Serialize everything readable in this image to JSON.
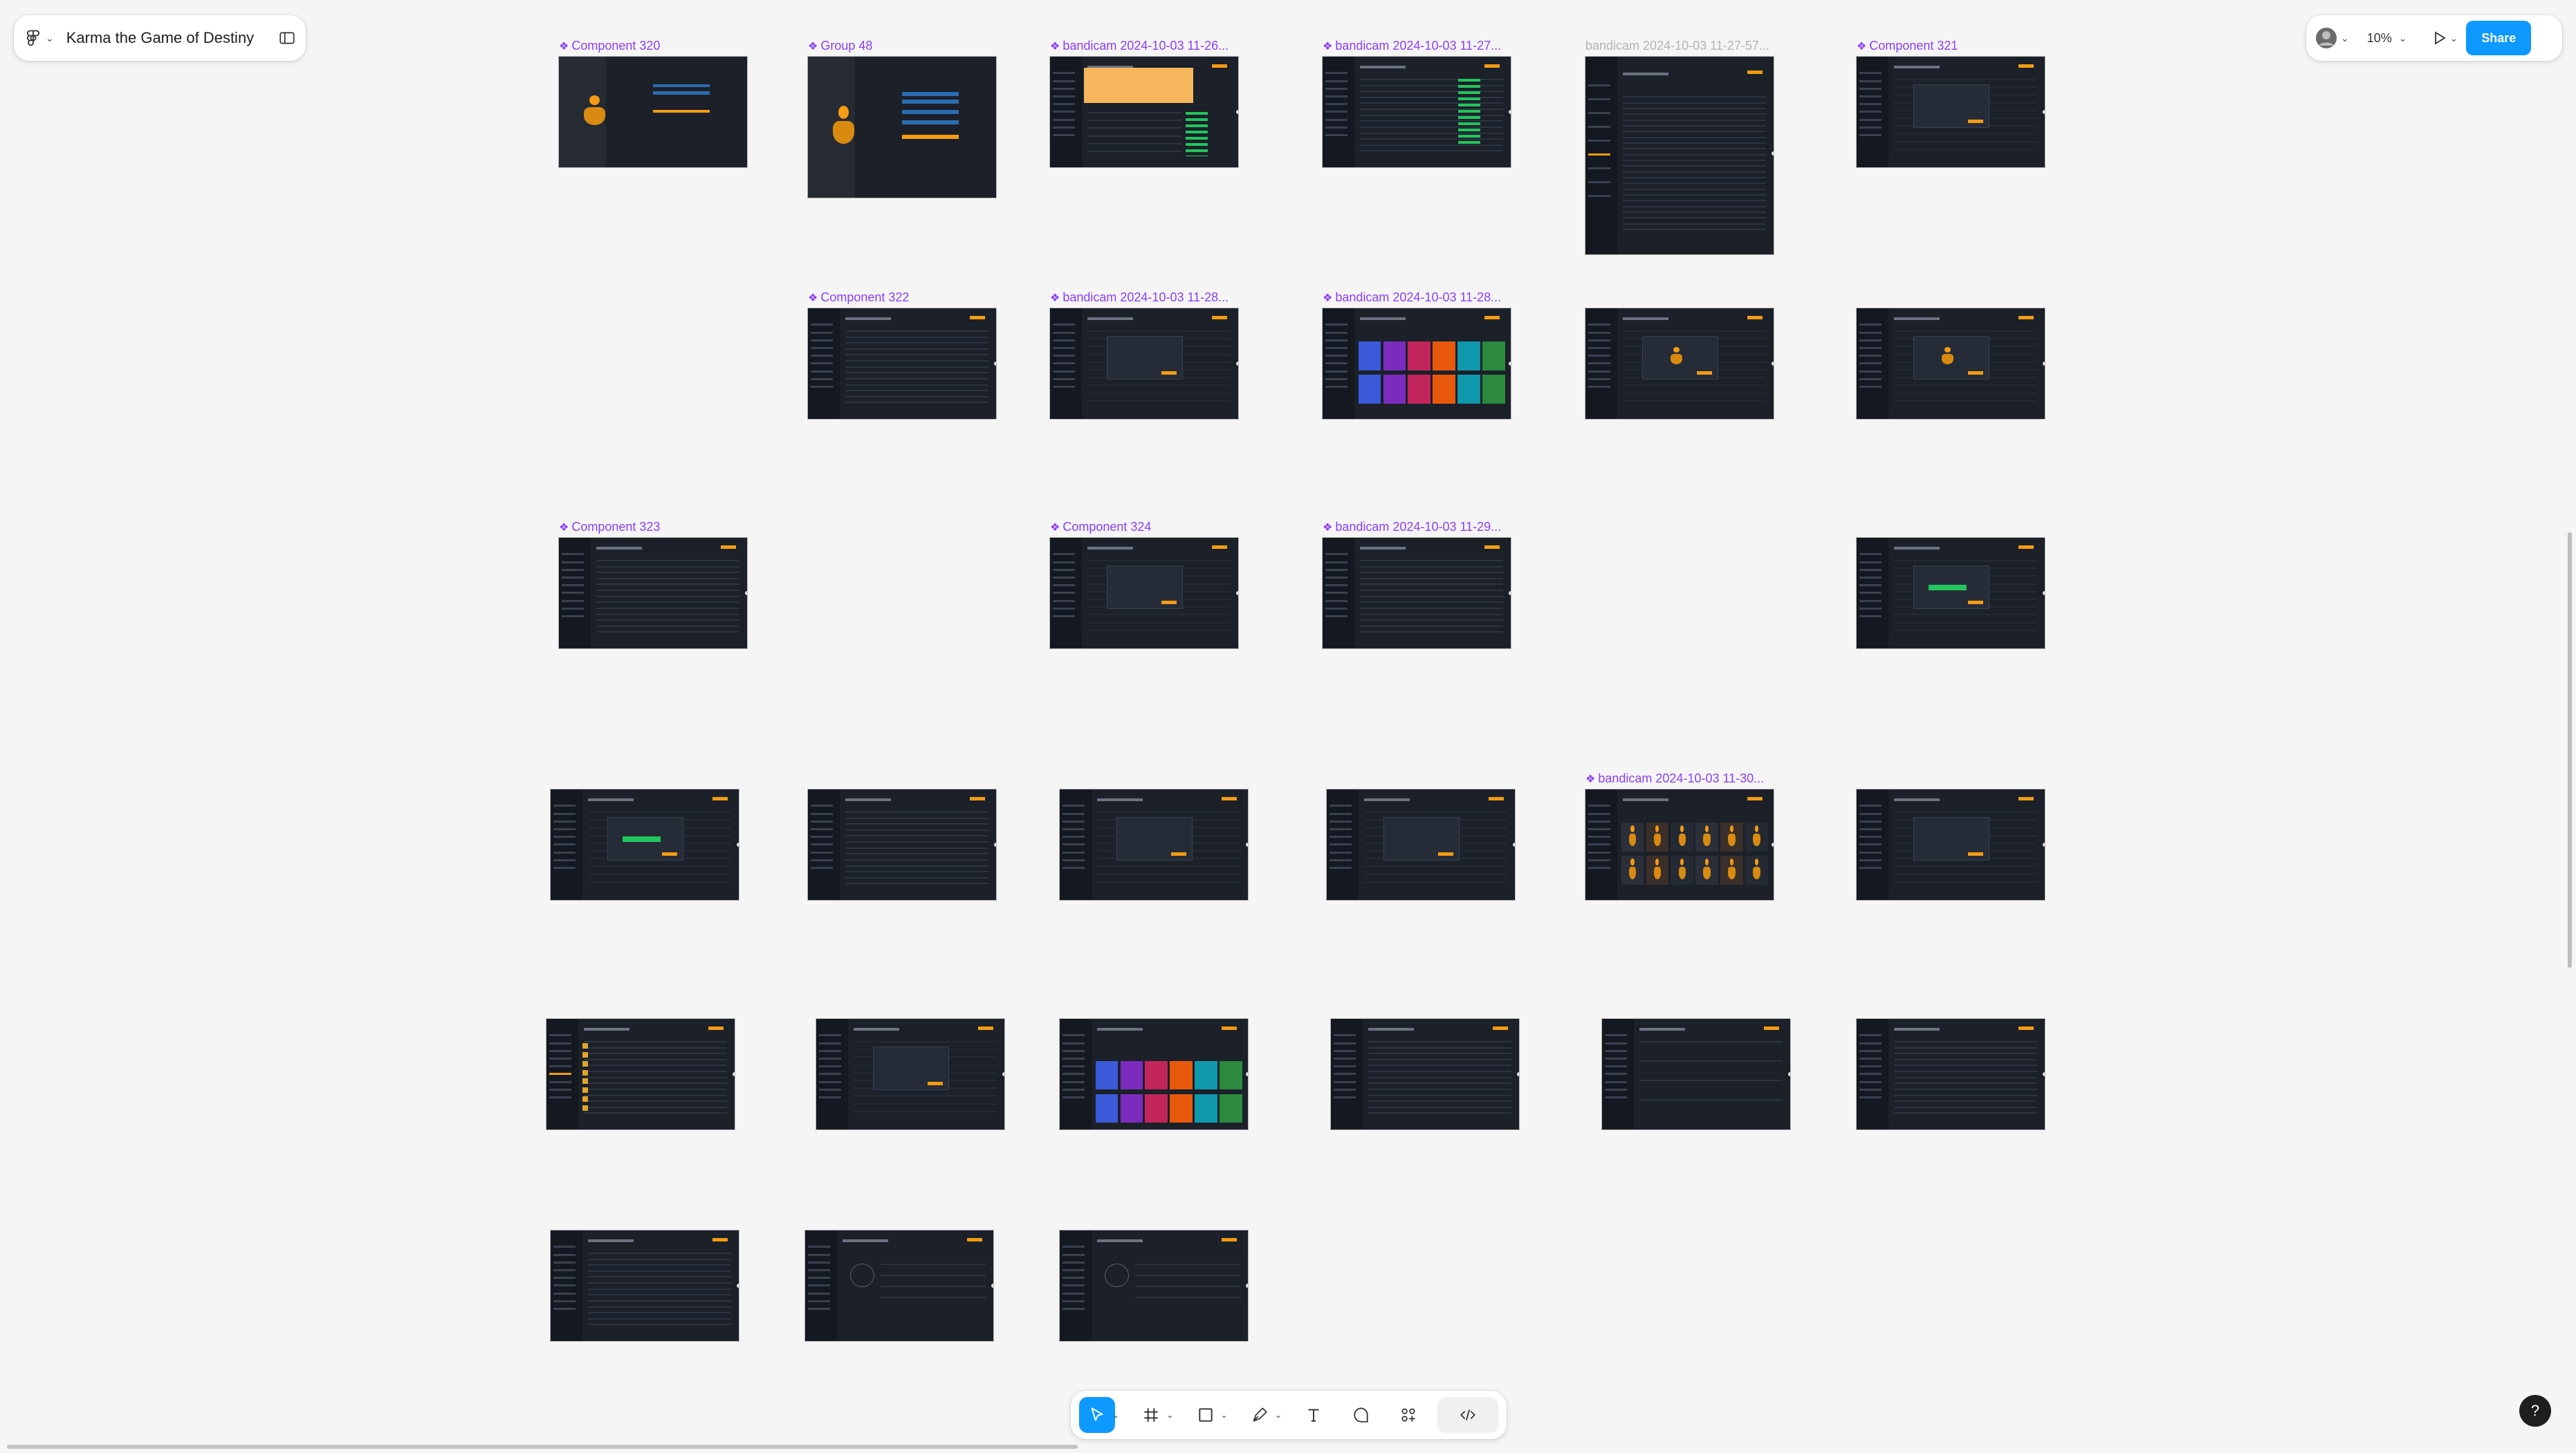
{
  "file": {
    "name": "Karma the Game of Destiny"
  },
  "toolbar_top_right": {
    "zoom": "10%",
    "share_label": "Share"
  },
  "bottom_tools": [
    "move",
    "frame",
    "shape",
    "pen",
    "text",
    "comment",
    "actions",
    "dev-mode"
  ],
  "help_label": "?",
  "accent": "#0d99ff",
  "component_color": "#8a3ffc",
  "frames": [
    {
      "label": "Component 320",
      "component": true,
      "kind": "login",
      "col": 0,
      "row": 0,
      "variant": "a"
    },
    {
      "label": "Group 48",
      "component": true,
      "kind": "login2",
      "col": 1,
      "row": 0,
      "variant": "b"
    },
    {
      "label": "bandicam 2024-10-03 11-26...",
      "component": true,
      "kind": "banner",
      "col": 2,
      "row": 0
    },
    {
      "label": "bandicam 2024-10-03 11-27...",
      "component": true,
      "kind": "table-green",
      "col": 3,
      "row": 0
    },
    {
      "label": "bandicam 2024-10-03 11-27-57...",
      "component": false,
      "muted": true,
      "kind": "table-tall",
      "col": 4,
      "row": 0
    },
    {
      "label": "Component 321",
      "component": true,
      "kind": "modal",
      "col": 5,
      "row": 0
    },
    {
      "label": "Component 322",
      "component": true,
      "kind": "table",
      "col": 1,
      "row": 1
    },
    {
      "label": "bandicam 2024-10-03 11-28...",
      "component": true,
      "kind": "modal",
      "col": 2,
      "row": 1
    },
    {
      "label": "bandicam 2024-10-03 11-28...",
      "component": true,
      "kind": "gallery",
      "col": 3,
      "row": 1
    },
    {
      "label": "",
      "component": false,
      "kind": "modal-figure",
      "col": 4,
      "row": 1
    },
    {
      "label": "",
      "component": false,
      "kind": "modal-figure",
      "col": 5,
      "row": 1
    },
    {
      "label": "Component 323",
      "component": true,
      "kind": "table",
      "col": 0,
      "row": 2
    },
    {
      "label": "Component 324",
      "component": true,
      "kind": "modal",
      "col": 2,
      "row": 2
    },
    {
      "label": "bandicam 2024-10-03 11-29...",
      "component": true,
      "kind": "table",
      "col": 3,
      "row": 2
    },
    {
      "label": "",
      "component": false,
      "kind": "modal-green",
      "col": 5,
      "row": 2
    },
    {
      "label": "",
      "component": false,
      "kind": "modal-green",
      "col": 0,
      "row": 3
    },
    {
      "label": "",
      "component": false,
      "kind": "table",
      "col": 1,
      "row": 3
    },
    {
      "label": "",
      "component": false,
      "kind": "modal",
      "col": 2,
      "row": 3
    },
    {
      "label": "",
      "component": false,
      "kind": "modal",
      "col": 3,
      "row": 3
    },
    {
      "label": "bandicam 2024-10-03 11-30...",
      "component": true,
      "kind": "characters",
      "col": 4,
      "row": 3
    },
    {
      "label": "",
      "component": false,
      "kind": "modal",
      "col": 5,
      "row": 3
    },
    {
      "label": "",
      "component": false,
      "kind": "list-gold",
      "col": 0,
      "row": 4
    },
    {
      "label": "",
      "component": false,
      "kind": "modal",
      "col": 1,
      "row": 4
    },
    {
      "label": "",
      "component": false,
      "kind": "gallery2",
      "col": 2,
      "row": 4
    },
    {
      "label": "",
      "component": false,
      "kind": "table",
      "col": 3,
      "row": 4
    },
    {
      "label": "",
      "component": false,
      "kind": "table-short",
      "col": 4,
      "row": 4
    },
    {
      "label": "",
      "component": false,
      "kind": "table",
      "col": 5,
      "row": 4
    },
    {
      "label": "",
      "component": false,
      "kind": "table",
      "col": 0,
      "row": 5
    },
    {
      "label": "",
      "component": false,
      "kind": "form",
      "col": 1,
      "row": 5
    },
    {
      "label": "",
      "component": false,
      "kind": "form",
      "col": 2,
      "row": 5
    }
  ]
}
